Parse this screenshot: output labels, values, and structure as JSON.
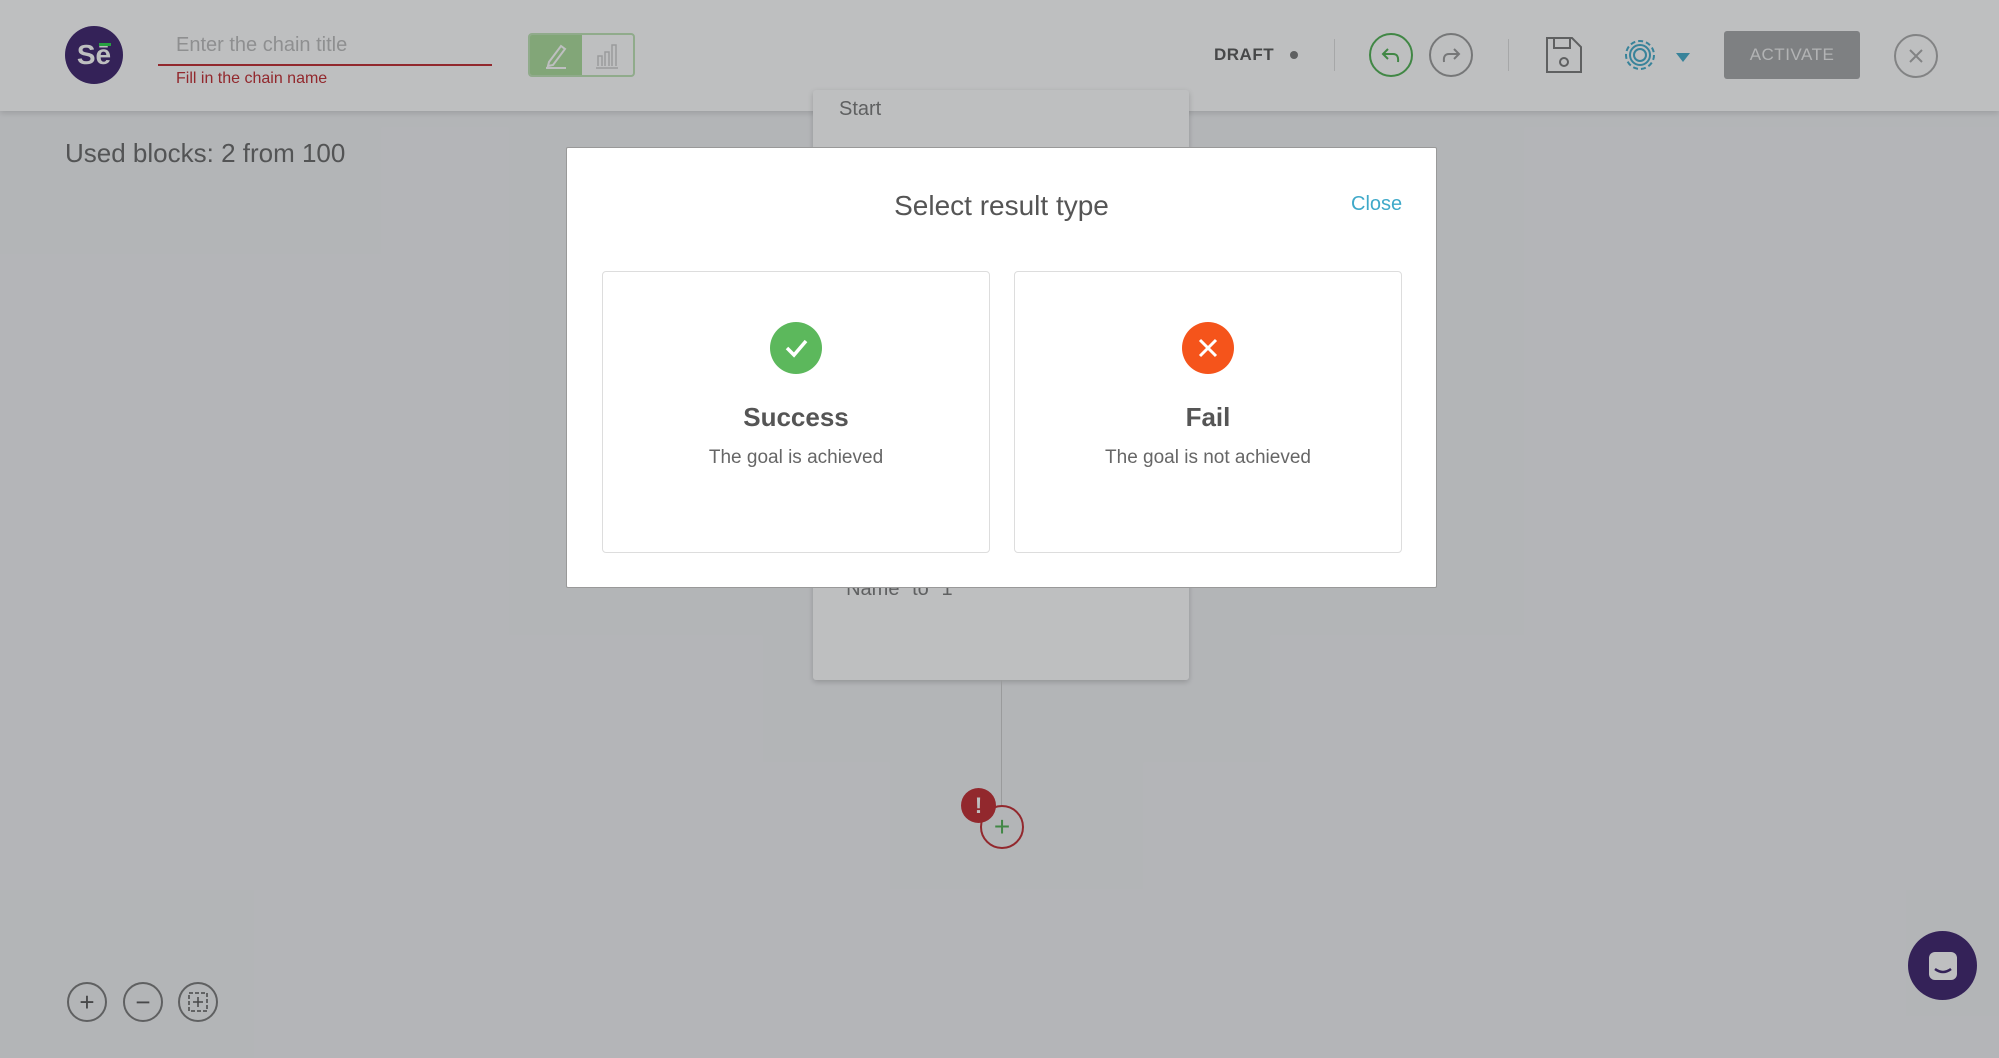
{
  "header": {
    "logo": "Sē",
    "title_placeholder": "Enter the chain title",
    "title_value": "",
    "title_error": "Fill in the chain name",
    "status": "DRAFT",
    "activate_label": "ACTIVATE"
  },
  "canvas": {
    "used_blocks": "Used blocks: 2 from 100",
    "node_title": "Start",
    "node_text": "\"Name\" to \"1\"",
    "error_mark": "!",
    "add_label": "+"
  },
  "zoom_controls": {
    "zoom_in": "+",
    "zoom_out": "−"
  },
  "modal": {
    "title": "Select result type",
    "close_label": "Close",
    "options": [
      {
        "title": "Success",
        "subtitle": "The goal is achieved",
        "color": "#5cb85c"
      },
      {
        "title": "Fail",
        "subtitle": "The goal is not achieved",
        "color": "#f5541b"
      }
    ]
  },
  "colors": {
    "brand": "#3a1f6b",
    "error": "#c0272d",
    "link": "#3fa9c9"
  }
}
